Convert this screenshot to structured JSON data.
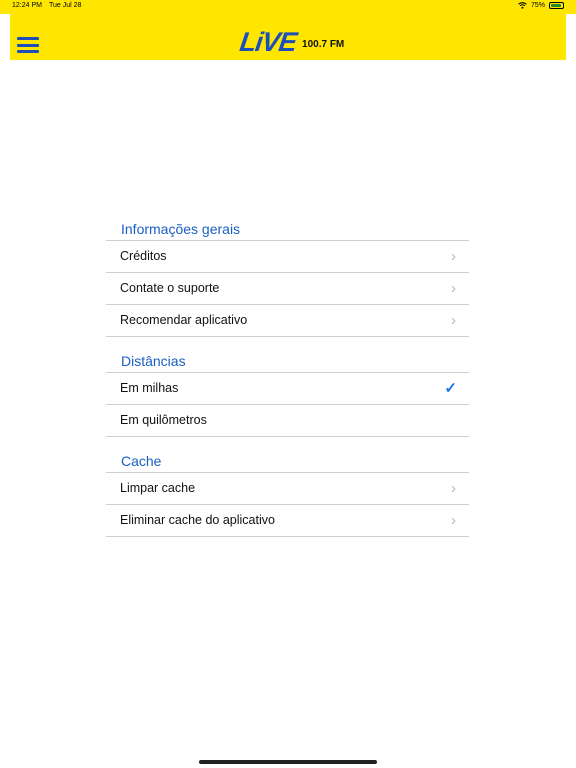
{
  "status": {
    "time": "12:24 PM",
    "date": "Tue Jul 28",
    "battery": "75%"
  },
  "header": {
    "logo_text": "LiVE",
    "frequency": "100.7 FM"
  },
  "sections": {
    "general": {
      "title": "Informações gerais",
      "items": [
        "Créditos",
        "Contate o suporte",
        "Recomendar aplicativo"
      ]
    },
    "distances": {
      "title": "Distâncias",
      "items": [
        "Em milhas",
        "Em quilômetros"
      ],
      "selected_index": 0
    },
    "cache": {
      "title": "Cache",
      "items": [
        "Limpar cache",
        "Eliminar cache do aplicativo"
      ]
    }
  },
  "colors": {
    "header_bg": "#ffe600",
    "accent": "#1a5fc4",
    "logo_blue": "#1d4fb8"
  }
}
